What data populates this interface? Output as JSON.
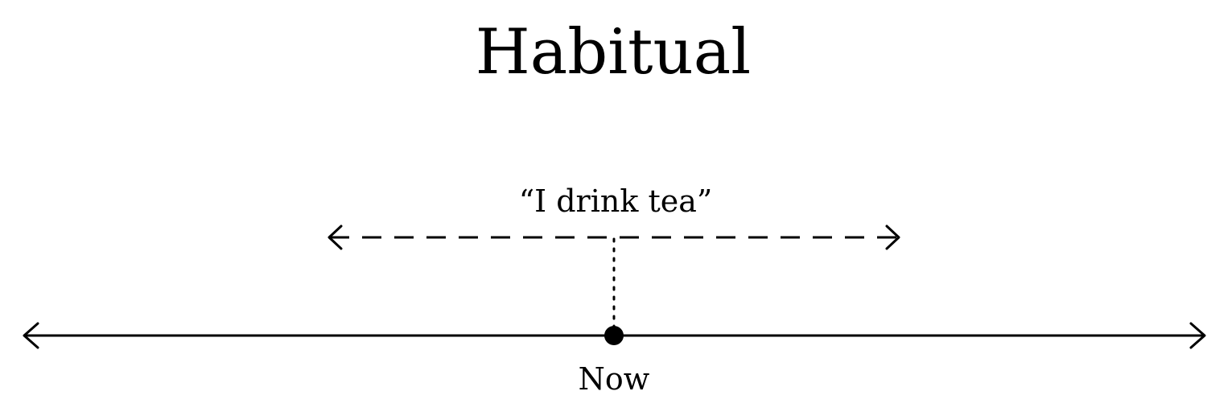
{
  "diagram": {
    "title": "Habitual",
    "example_sentence": "“I drink tea”",
    "now_label": "Now"
  }
}
